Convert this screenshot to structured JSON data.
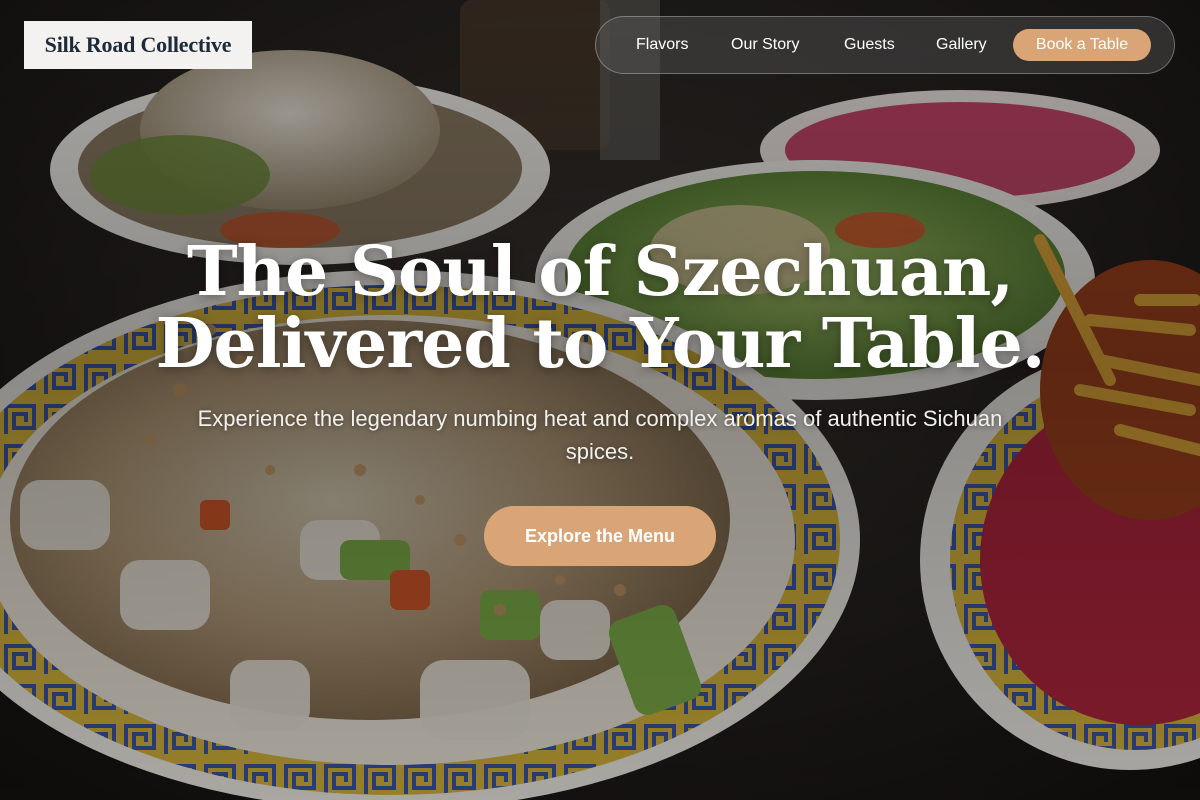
{
  "brand": {
    "name": "Silk Road Collective"
  },
  "nav": {
    "links": [
      {
        "label": "Flavors"
      },
      {
        "label": "Our Story"
      },
      {
        "label": "Guests"
      },
      {
        "label": "Gallery"
      }
    ],
    "cta_label": "Book a Table"
  },
  "hero": {
    "headline_line1": "The Soul of Szechuan,",
    "headline_line2": "Delivered to Your Table.",
    "subtitle": "Experience the legendary numbing heat and complex aromas of authentic Sichuan spices.",
    "cta_label": "Explore the Menu",
    "background_icon": "food-photo"
  },
  "colors": {
    "accent": "#d9a576",
    "brand_text": "#1e2a3a",
    "brand_bg": "#f3f2f0",
    "text_light": "#ffffff"
  }
}
